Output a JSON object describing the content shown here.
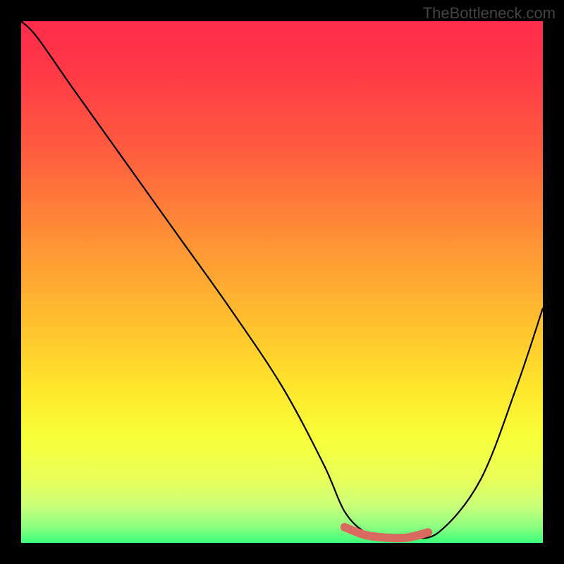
{
  "watermark": "TheBottleneck.com",
  "chart_data": {
    "type": "line",
    "title": "",
    "xlabel": "",
    "ylabel": "",
    "xlim": [
      0,
      100
    ],
    "ylim": [
      0,
      100
    ],
    "series": [
      {
        "name": "curve",
        "x": [
          0,
          3,
          10,
          20,
          30,
          40,
          50,
          58,
          62,
          66,
          70,
          74,
          80,
          88,
          95,
          100
        ],
        "y": [
          100,
          97,
          87,
          73,
          59,
          45,
          30,
          15,
          6,
          2,
          1,
          1,
          2,
          12,
          30,
          45
        ]
      },
      {
        "name": "highlight",
        "x": [
          62,
          66,
          70,
          74,
          78
        ],
        "y": [
          3,
          1.5,
          1,
          1,
          2
        ]
      }
    ],
    "gradient_colors": {
      "top": "#ff2b4a",
      "mid_upper": "#ff8c36",
      "mid": "#ffe52c",
      "mid_lower": "#e8ff5a",
      "bottom": "#3aff7a"
    },
    "highlight_color": "#d96a5f"
  }
}
